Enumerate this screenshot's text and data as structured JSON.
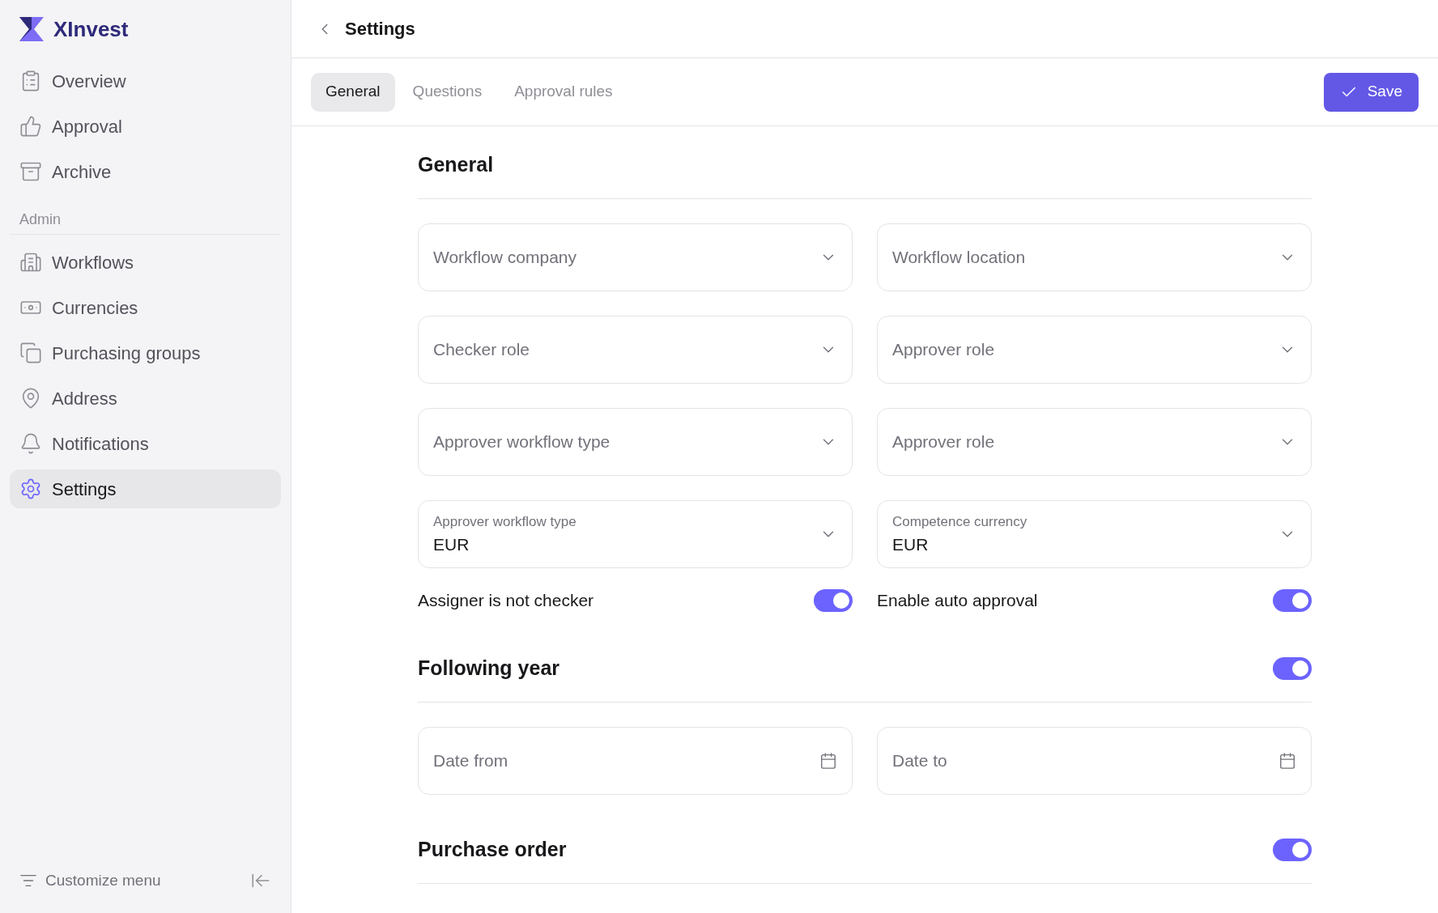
{
  "sidebar": {
    "brand": "XInvest",
    "groups": [
      {
        "items": [
          {
            "label": "Overview",
            "selected": false
          },
          {
            "label": "Approval",
            "selected": false
          },
          {
            "label": "Archive",
            "selected": false
          }
        ]
      },
      {
        "heading": "Admin",
        "items": [
          {
            "label": "Workflows",
            "selected": false
          },
          {
            "label": "Currencies",
            "selected": false
          },
          {
            "label": "Purchasing groups",
            "selected": false
          },
          {
            "label": "Address",
            "selected": false
          },
          {
            "label": "Notifications",
            "selected": false
          },
          {
            "label": "Settings",
            "selected": true
          }
        ]
      }
    ],
    "footer": {
      "label": "Customize menu"
    }
  },
  "header": {
    "title": "Settings"
  },
  "tabs": [
    {
      "label": "General",
      "selected": true
    },
    {
      "label": "Questions",
      "selected": false
    },
    {
      "label": "Approval rules",
      "selected": false
    }
  ],
  "save_button": "Save",
  "sections": [
    {
      "title": "General",
      "fields": [
        {
          "kind": "select",
          "placeholder": "Workflow company"
        },
        {
          "kind": "select",
          "placeholder": "Workflow location"
        },
        {
          "kind": "select",
          "placeholder": "Checker role"
        },
        {
          "kind": "select",
          "placeholder": "Approver role"
        },
        {
          "kind": "select",
          "placeholder": "Approver workflow type"
        },
        {
          "kind": "select",
          "placeholder": "Approver role"
        },
        {
          "kind": "select",
          "label": "Approver workflow type",
          "value": "EUR"
        },
        {
          "kind": "select",
          "label": "Competence currency",
          "value": "EUR"
        }
      ],
      "toggles": [
        {
          "label": "Assigner is not checker",
          "on": true
        },
        {
          "label": "Enable auto approval",
          "on": true
        }
      ]
    },
    {
      "title": "Following year",
      "on": true,
      "fields": [
        {
          "kind": "date",
          "placeholder": "Date from"
        },
        {
          "kind": "date",
          "placeholder": "Date to"
        }
      ]
    },
    {
      "title": "Purchase order",
      "on": true
    }
  ]
}
